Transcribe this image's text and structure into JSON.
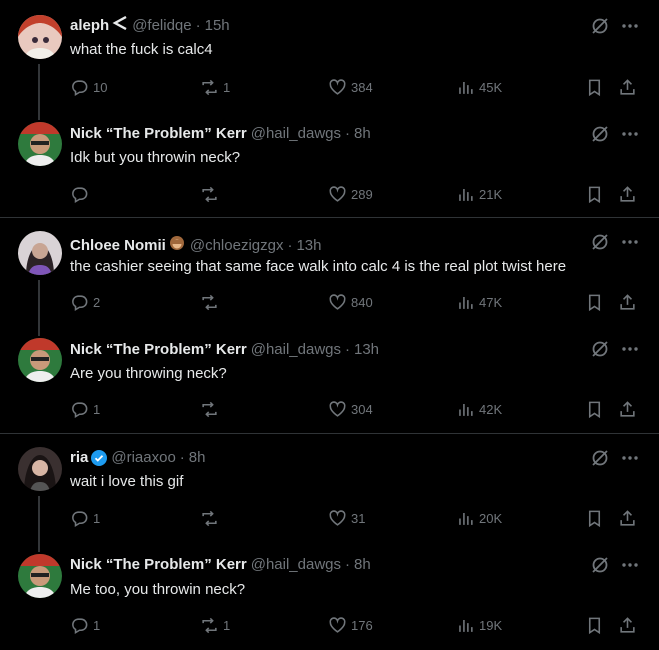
{
  "posts": [
    {
      "name": "aleph",
      "name_suffix_icon": "lightning-icon",
      "handle": "@felidqe",
      "time": "15h",
      "text": "what the fuck is calc4",
      "replies": "10",
      "reposts": "1",
      "likes": "384",
      "views": "45K"
    },
    {
      "name": "Nick “The Problem” Kerr",
      "handle": "@hail_dawgs",
      "time": "8h",
      "text": "Idk but you throwin neck?",
      "replies": "",
      "reposts": "",
      "likes": "289",
      "views": "21K"
    },
    {
      "name": "Chloee Nomii",
      "name_suffix_icon": "see-no-evil-monkey-emoji",
      "handle": "@chloezigzgx",
      "time": "13h",
      "text": "the cashier seeing that same face walk into calc 4 is the real plot twist here",
      "replies": "2",
      "reposts": "",
      "likes": "840",
      "views": "47K"
    },
    {
      "name": "Nick “The Problem” Kerr",
      "handle": "@hail_dawgs",
      "time": "13h",
      "text": "Are you throwing neck?",
      "replies": "1",
      "reposts": "",
      "likes": "304",
      "views": "42K"
    },
    {
      "name": "ria",
      "name_suffix_icon": "verified-badge-icon",
      "handle": "@riaaxoo",
      "time": "8h",
      "text": "wait i love this gif",
      "replies": "1",
      "reposts": "",
      "likes": "31",
      "views": "20K"
    },
    {
      "name": "Nick “The Problem” Kerr",
      "handle": "@hail_dawgs",
      "time": "8h",
      "text": "Me too, you throwin neck?",
      "replies": "1",
      "reposts": "1",
      "likes": "176",
      "views": "19K"
    }
  ],
  "separator": "·",
  "colors": {
    "background": "#000000",
    "text": "#e7e9ea",
    "muted": "#71767b",
    "divider": "#2f3336",
    "verified": "#1d9bf0"
  }
}
